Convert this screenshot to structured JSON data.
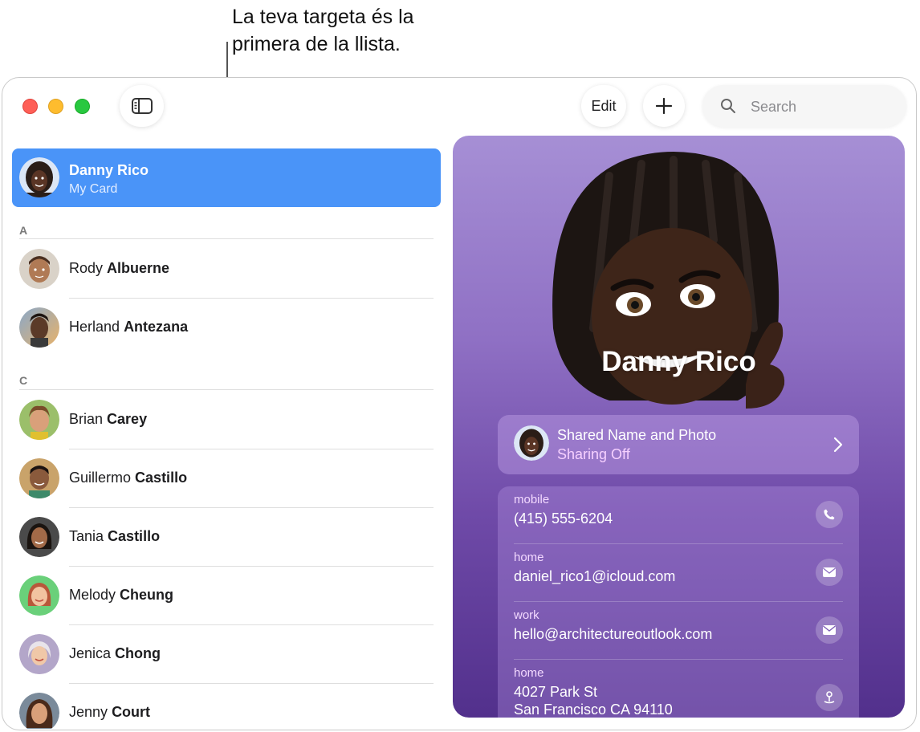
{
  "callout": {
    "line1": "La teva targeta és la",
    "line2": "primera de la llista."
  },
  "toolbar": {
    "sidebar_icon": "sidebar-toggle-icon",
    "edit_label": "Edit",
    "add_icon": "plus-icon",
    "search_placeholder": "Search"
  },
  "my_card": {
    "name": "Danny Rico",
    "subtitle": "My Card"
  },
  "sections": [
    {
      "letter": "A",
      "contacts": [
        {
          "first": "Rody",
          "last": "Albuerne"
        },
        {
          "first": "Herland",
          "last": "Antezana"
        }
      ]
    },
    {
      "letter": "C",
      "contacts": [
        {
          "first": "Brian",
          "last": "Carey"
        },
        {
          "first": "Guillermo",
          "last": "Castillo"
        },
        {
          "first": "Tania",
          "last": "Castillo"
        },
        {
          "first": "Melody",
          "last": "Cheung"
        },
        {
          "first": "Jenica",
          "last": "Chong"
        },
        {
          "first": "Jenny",
          "last": "Court"
        }
      ]
    }
  ],
  "detail": {
    "name": "Danny Rico",
    "shared": {
      "title": "Shared Name and Photo",
      "status": "Sharing Off"
    },
    "fields": [
      {
        "label": "mobile",
        "value": "(415) 555-6204",
        "action_icon": "phone-icon"
      },
      {
        "label": "home",
        "value": "daniel_rico1@icloud.com",
        "action_icon": "mail-icon"
      },
      {
        "label": "work",
        "value": "hello@architectureoutlook.com",
        "action_icon": "mail-icon"
      },
      {
        "label": "home",
        "value": "4027 Park St",
        "value2": "San Francisco CA 94110",
        "action_icon": "map-pin-icon"
      }
    ]
  },
  "colors": {
    "selection": "#4a94f8",
    "detail_top": "#a68fd5",
    "detail_bottom": "#52308c"
  }
}
